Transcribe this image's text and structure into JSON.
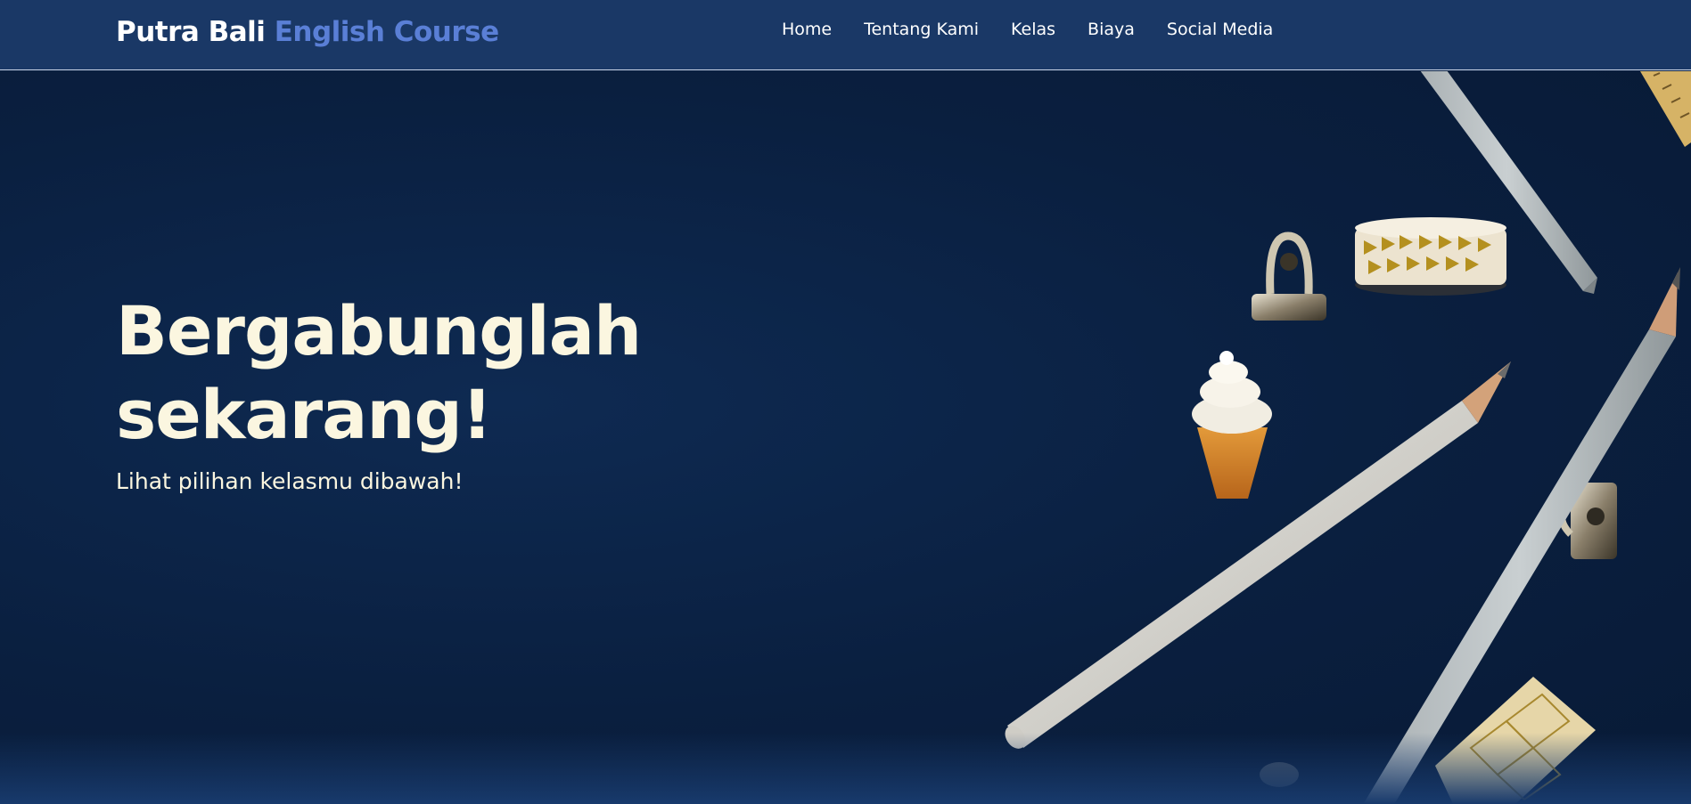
{
  "brand": {
    "name_primary": "Putra Bali",
    "name_accent": "English Course"
  },
  "nav": {
    "items": [
      {
        "label": "Home"
      },
      {
        "label": "Tentang Kami"
      },
      {
        "label": "Kelas"
      },
      {
        "label": "Biaya"
      },
      {
        "label": "Social Media"
      }
    ]
  },
  "hero": {
    "title_line1": "Bergabunglah",
    "title_line2": "sekarang!",
    "subtitle": "Lihat pilihan kelasmu dibawah!",
    "image_description_icons": [
      "pencil-icon",
      "binder-clip-icon",
      "washi-tape-icon",
      "ice-cream-eraser-icon",
      "ruler-icon"
    ]
  },
  "colors": {
    "navbar_bg": "#1a3866",
    "hero_bg": "#0c2347",
    "brand_accent": "#5a7fd6",
    "hero_text": "#fbf6e0"
  }
}
